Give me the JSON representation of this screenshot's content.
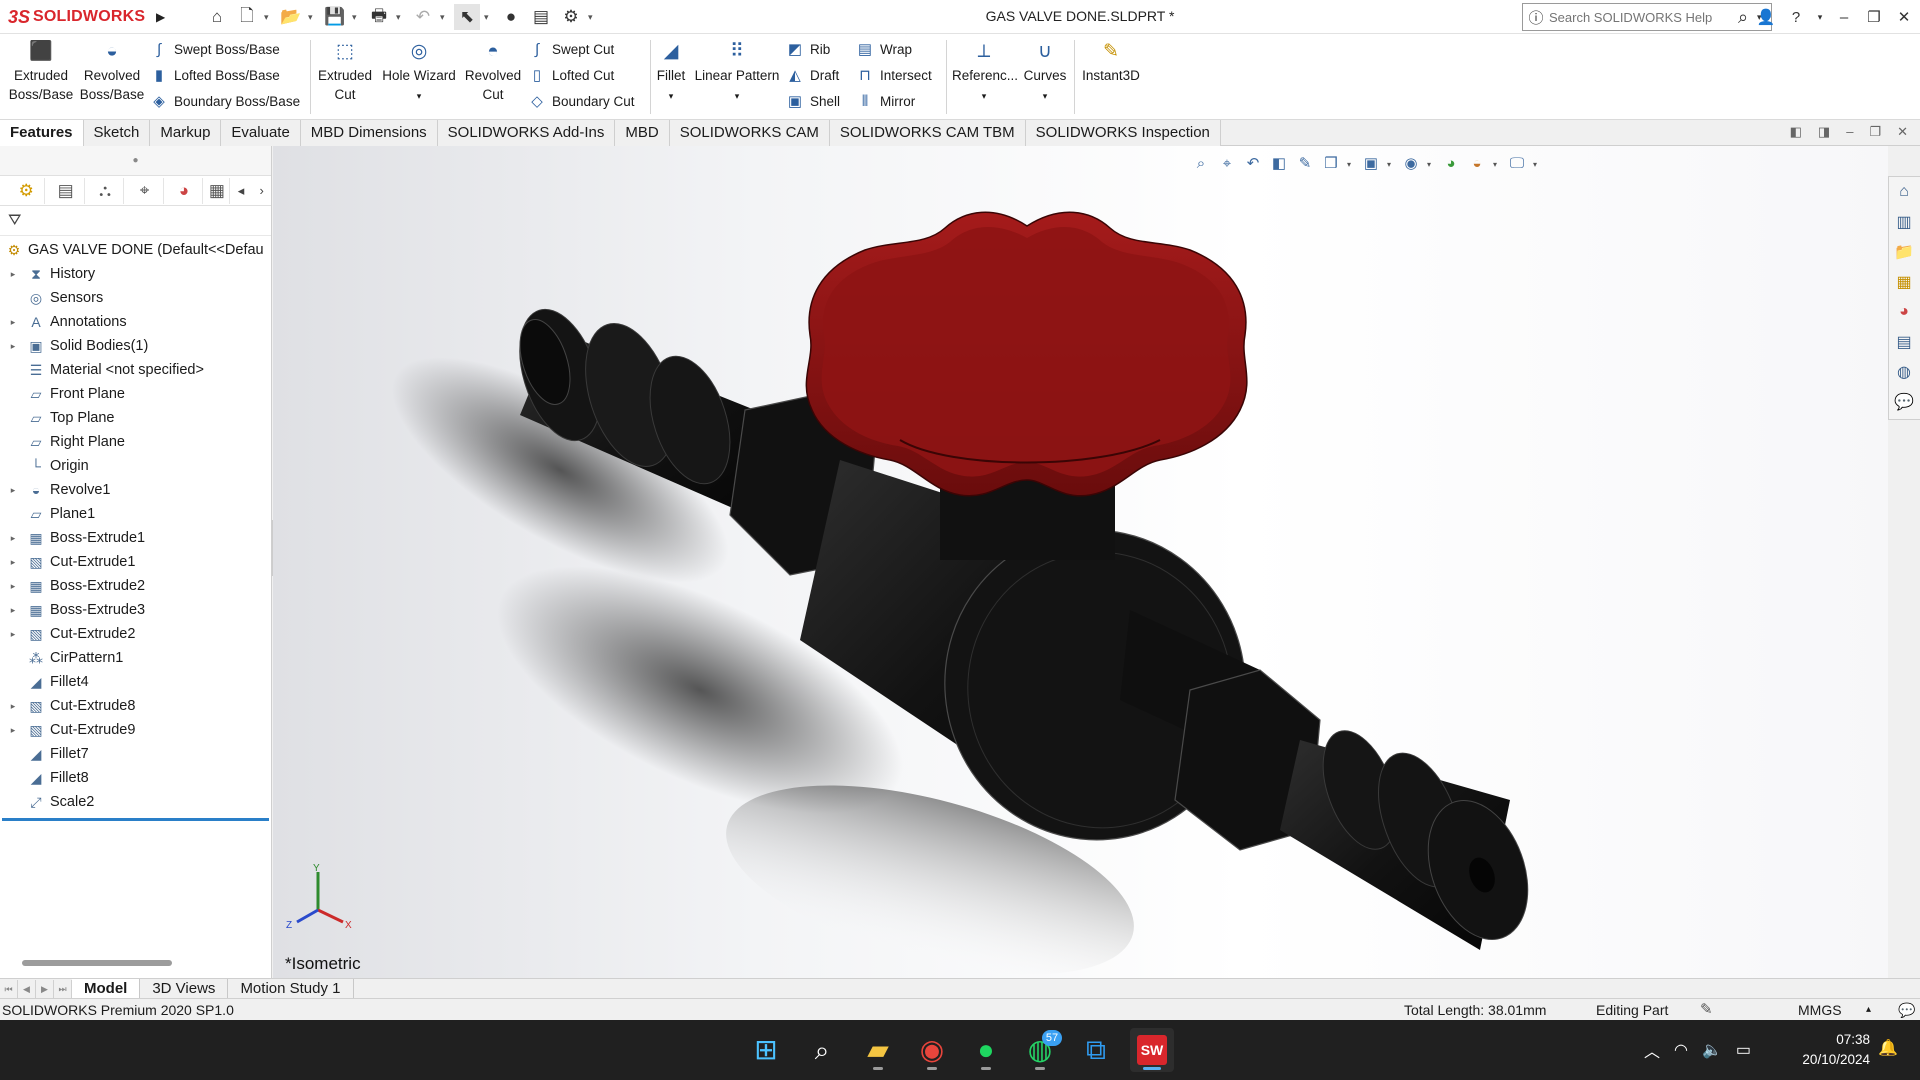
{
  "app": {
    "logo_ds": "3S",
    "logo_name": "SOLIDWORKS",
    "doc_title": "GAS VALVE DONE.SLDPRT *",
    "search_placeholder": "Search SOLIDWORKS Help"
  },
  "ribbon": {
    "extruded_boss": [
      "Extruded",
      "Boss/Base"
    ],
    "revolved_boss": [
      "Revolved",
      "Boss/Base"
    ],
    "swept_boss": "Swept Boss/Base",
    "lofted_boss": "Lofted Boss/Base",
    "boundary_boss": "Boundary Boss/Base",
    "extruded_cut": [
      "Extruded",
      "Cut"
    ],
    "hole_wizard": "Hole Wizard",
    "revolved_cut": [
      "Revolved",
      "Cut"
    ],
    "swept_cut": "Swept Cut",
    "lofted_cut": "Lofted Cut",
    "boundary_cut": "Boundary Cut",
    "fillet": "Fillet",
    "linear_pattern": "Linear Pattern",
    "rib": "Rib",
    "draft": "Draft",
    "shell": "Shell",
    "wrap": "Wrap",
    "intersect": "Intersect",
    "mirror": "Mirror",
    "reference": "Referenc...",
    "curves": "Curves",
    "instant3d": "Instant3D"
  },
  "tabs": [
    "Features",
    "Sketch",
    "Markup",
    "Evaluate",
    "MBD Dimensions",
    "SOLIDWORKS Add-Ins",
    "MBD",
    "SOLIDWORKS CAM",
    "SOLIDWORKS CAM TBM",
    "SOLIDWORKS Inspection"
  ],
  "tree": {
    "root": "GAS VALVE DONE  (Default<<Defau",
    "items": [
      {
        "label": "History",
        "icon": "history-icon",
        "expand": true
      },
      {
        "label": "Sensors",
        "icon": "sensors-icon",
        "expand": false
      },
      {
        "label": "Annotations",
        "icon": "annotations-icon",
        "expand": true
      },
      {
        "label": "Solid Bodies(1)",
        "icon": "solid-bodies-icon",
        "expand": true
      },
      {
        "label": "Material <not specified>",
        "icon": "material-icon",
        "expand": false
      },
      {
        "label": "Front Plane",
        "icon": "plane-icon",
        "expand": false
      },
      {
        "label": "Top Plane",
        "icon": "plane-icon",
        "expand": false
      },
      {
        "label": "Right Plane",
        "icon": "plane-icon",
        "expand": false
      },
      {
        "label": "Origin",
        "icon": "origin-icon",
        "expand": false
      },
      {
        "label": "Revolve1",
        "icon": "revolve-icon",
        "expand": true
      },
      {
        "label": "Plane1",
        "icon": "plane-icon",
        "expand": false
      },
      {
        "label": "Boss-Extrude1",
        "icon": "extrude-icon",
        "expand": true
      },
      {
        "label": "Cut-Extrude1",
        "icon": "cut-extrude-icon",
        "expand": true
      },
      {
        "label": "Boss-Extrude2",
        "icon": "extrude-icon",
        "expand": true
      },
      {
        "label": "Boss-Extrude3",
        "icon": "extrude-icon",
        "expand": true
      },
      {
        "label": "Cut-Extrude2",
        "icon": "cut-extrude-icon",
        "expand": true
      },
      {
        "label": "CirPattern1",
        "icon": "circular-pattern-icon",
        "expand": false
      },
      {
        "label": "Fillet4",
        "icon": "fillet-icon",
        "expand": false
      },
      {
        "label": "Cut-Extrude8",
        "icon": "cut-extrude-icon",
        "expand": true
      },
      {
        "label": "Cut-Extrude9",
        "icon": "cut-extrude-icon",
        "expand": true
      },
      {
        "label": "Fillet7",
        "icon": "fillet-icon",
        "expand": false
      },
      {
        "label": "Fillet8",
        "icon": "fillet-icon",
        "expand": false
      },
      {
        "label": "Scale2",
        "icon": "scale-icon",
        "expand": false
      }
    ]
  },
  "viewport": {
    "view_label": "*Isometric",
    "triad": {
      "x": "X",
      "y": "Y",
      "z": "Z"
    }
  },
  "bottom_tabs": [
    "Model",
    "3D Views",
    "Motion Study 1"
  ],
  "status": {
    "product": "SOLIDWORKS Premium 2020 SP1.0",
    "length": "Total Length: 38.01mm",
    "mode": "Editing Part",
    "units": "MMGS"
  },
  "taskbar": {
    "whatsapp_badge": "57",
    "time": "07:38",
    "date": "20/10/2024",
    "sw_label": "SW"
  },
  "colors": {
    "handle": "#8e1414",
    "body": "#151515",
    "accent": "#d9262c"
  }
}
